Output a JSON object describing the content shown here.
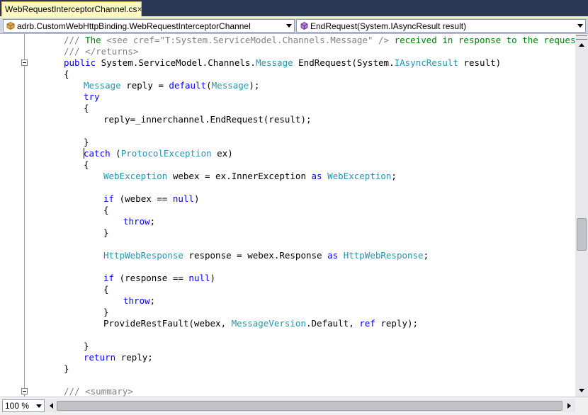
{
  "tab": {
    "title": "WebRequestInterceptorChannel.cs",
    "close_glyph": "×"
  },
  "navbar": {
    "type_selector": "adrb.CustomWebHttpBinding.WebRequestInterceptorChannel",
    "member_selector": "EndRequest(System.IAsyncResult result)"
  },
  "editor": {
    "lines": [
      {
        "indent": 7,
        "tokens": [
          {
            "t": "/// ",
            "c": "doc"
          },
          {
            "t": "The ",
            "c": "cmt"
          },
          {
            "t": "<see cref=\"T:System.ServiceModel.Channels.Message\" />",
            "c": "doc"
          },
          {
            "t": " received in response to the request.",
            "c": "cmt"
          }
        ]
      },
      {
        "indent": 7,
        "tokens": [
          {
            "t": "/// ",
            "c": "doc"
          },
          {
            "t": "</returns>",
            "c": "doc"
          }
        ]
      },
      {
        "indent": 7,
        "collapse": true,
        "tokens": [
          {
            "t": "public",
            "c": "kw"
          },
          {
            "t": " System.ServiceModel.Channels.",
            "c": ""
          },
          {
            "t": "Message",
            "c": "type"
          },
          {
            "t": " EndRequest(System.",
            "c": ""
          },
          {
            "t": "IAsyncResult",
            "c": "type"
          },
          {
            "t": " result)",
            "c": ""
          }
        ]
      },
      {
        "indent": 7,
        "tokens": [
          {
            "t": "{",
            "c": ""
          }
        ]
      },
      {
        "indent": 11,
        "tokens": [
          {
            "t": "Message",
            "c": "type"
          },
          {
            "t": " reply = ",
            "c": ""
          },
          {
            "t": "default",
            "c": "kw"
          },
          {
            "t": "(",
            "c": ""
          },
          {
            "t": "Message",
            "c": "type"
          },
          {
            "t": ");",
            "c": ""
          }
        ]
      },
      {
        "indent": 11,
        "tokens": [
          {
            "t": "try",
            "c": "kw"
          }
        ]
      },
      {
        "indent": 11,
        "tokens": [
          {
            "t": "{",
            "c": ""
          }
        ]
      },
      {
        "indent": 15,
        "tokens": [
          {
            "t": "reply=_innerchannel.EndRequest(result);",
            "c": ""
          }
        ]
      },
      {
        "indent": 0,
        "tokens": []
      },
      {
        "indent": 11,
        "tokens": [
          {
            "t": "}",
            "c": ""
          }
        ]
      },
      {
        "indent": 11,
        "caret": true,
        "tokens": [
          {
            "t": "catch",
            "c": "kw"
          },
          {
            "t": " (",
            "c": ""
          },
          {
            "t": "ProtocolException",
            "c": "type"
          },
          {
            "t": " ex)",
            "c": ""
          }
        ]
      },
      {
        "indent": 11,
        "tokens": [
          {
            "t": "{",
            "c": ""
          }
        ]
      },
      {
        "indent": 15,
        "tokens": [
          {
            "t": "WebException",
            "c": "type"
          },
          {
            "t": " webex = ex.InnerException ",
            "c": ""
          },
          {
            "t": "as",
            "c": "kw"
          },
          {
            "t": " ",
            "c": ""
          },
          {
            "t": "WebException",
            "c": "type"
          },
          {
            "t": ";",
            "c": ""
          }
        ]
      },
      {
        "indent": 0,
        "tokens": []
      },
      {
        "indent": 15,
        "tokens": [
          {
            "t": "if",
            "c": "kw"
          },
          {
            "t": " (webex == ",
            "c": ""
          },
          {
            "t": "null",
            "c": "kw"
          },
          {
            "t": ")",
            "c": ""
          }
        ]
      },
      {
        "indent": 15,
        "tokens": [
          {
            "t": "{",
            "c": ""
          }
        ]
      },
      {
        "indent": 19,
        "tokens": [
          {
            "t": "throw",
            "c": "kw"
          },
          {
            "t": ";",
            "c": ""
          }
        ]
      },
      {
        "indent": 15,
        "tokens": [
          {
            "t": "}",
            "c": ""
          }
        ]
      },
      {
        "indent": 0,
        "tokens": []
      },
      {
        "indent": 15,
        "tokens": [
          {
            "t": "HttpWebResponse",
            "c": "type"
          },
          {
            "t": " response = webex.Response ",
            "c": ""
          },
          {
            "t": "as",
            "c": "kw"
          },
          {
            "t": " ",
            "c": ""
          },
          {
            "t": "HttpWebResponse",
            "c": "type"
          },
          {
            "t": ";",
            "c": ""
          }
        ]
      },
      {
        "indent": 0,
        "tokens": []
      },
      {
        "indent": 15,
        "tokens": [
          {
            "t": "if",
            "c": "kw"
          },
          {
            "t": " (response == ",
            "c": ""
          },
          {
            "t": "null",
            "c": "kw"
          },
          {
            "t": ")",
            "c": ""
          }
        ]
      },
      {
        "indent": 15,
        "tokens": [
          {
            "t": "{",
            "c": ""
          }
        ]
      },
      {
        "indent": 19,
        "tokens": [
          {
            "t": "throw",
            "c": "kw"
          },
          {
            "t": ";",
            "c": ""
          }
        ]
      },
      {
        "indent": 15,
        "tokens": [
          {
            "t": "}",
            "c": ""
          }
        ]
      },
      {
        "indent": 15,
        "tokens": [
          {
            "t": "ProvideRestFault(webex, ",
            "c": ""
          },
          {
            "t": "MessageVersion",
            "c": "type"
          },
          {
            "t": ".Default, ",
            "c": ""
          },
          {
            "t": "ref",
            "c": "kw"
          },
          {
            "t": " reply);",
            "c": ""
          }
        ]
      },
      {
        "indent": 0,
        "tokens": []
      },
      {
        "indent": 11,
        "tokens": [
          {
            "t": "}",
            "c": ""
          }
        ]
      },
      {
        "indent": 11,
        "tokens": [
          {
            "t": "return",
            "c": "kw"
          },
          {
            "t": " reply;",
            "c": ""
          }
        ]
      },
      {
        "indent": 7,
        "tokens": [
          {
            "t": "}",
            "c": ""
          }
        ]
      },
      {
        "indent": 0,
        "tokens": []
      },
      {
        "indent": 7,
        "collapse": true,
        "tokens": [
          {
            "t": "/// ",
            "c": "doc"
          },
          {
            "t": "<summary>",
            "c": "doc"
          }
        ]
      }
    ]
  },
  "bottombar": {
    "zoom": "100 %"
  },
  "colors": {
    "keyword": "#0000ff",
    "type": "#2b91af",
    "comment": "#008000",
    "doc_tag": "#808080",
    "tab_active": "#fff8c4",
    "chrome": "#293955"
  },
  "icons": {
    "type_selector": "class-icon",
    "member_selector": "method-icon",
    "dropdown": "chevron-down-icon"
  }
}
